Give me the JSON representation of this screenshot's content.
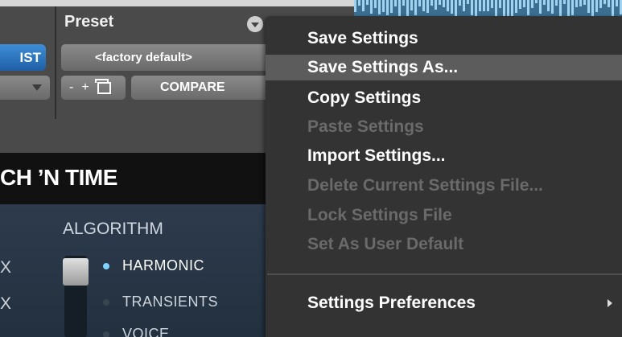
{
  "preset_section": {
    "label": "Preset",
    "bypass_label": "IST",
    "current_preset": "<factory default>",
    "minus_label": "-",
    "plus_label": "+",
    "compare_label": "COMPARE"
  },
  "plugin": {
    "title": "CH ’N TIME",
    "algorithm_label": "ALGORITHM",
    "left_labels": [
      "X",
      "X"
    ],
    "algorithm_options": [
      {
        "label": "HARMONIC",
        "selected": true
      },
      {
        "label": "TRANSIENTS",
        "selected": false
      },
      {
        "label": "VOICE",
        "selected": false
      }
    ],
    "accent_color": "#7fd3ff"
  },
  "context_menu": {
    "items": [
      {
        "label": "Save Settings",
        "enabled": true
      },
      {
        "label": "Save Settings As...",
        "enabled": true,
        "highlighted": true
      },
      {
        "label": "Copy Settings",
        "enabled": true
      },
      {
        "label": "Paste Settings",
        "enabled": false
      },
      {
        "label": "Import Settings...",
        "enabled": true
      },
      {
        "label": "Delete Current Settings File...",
        "enabled": false
      },
      {
        "label": "Lock Settings File",
        "enabled": false
      },
      {
        "label": "Set As User Default",
        "enabled": false
      }
    ],
    "footer_item": {
      "label": "Settings Preferences",
      "has_submenu": true
    }
  }
}
